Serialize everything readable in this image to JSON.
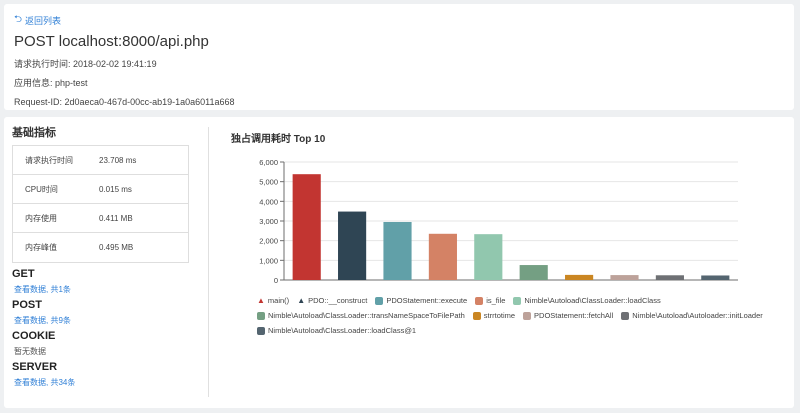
{
  "header": {
    "back_label": "返回列表",
    "request_title": "POST localhost:8000/api.php",
    "exec_time_line": "请求执行时间: 2018-02-02 19:41:19",
    "app_line": "应用信息: php-test",
    "request_id_line": "Request-ID: 2d0aeca0-467d-00cc-ab19-1a0a6011a668"
  },
  "metrics": {
    "title": "基础指标",
    "rows": [
      {
        "key": "请求执行时间",
        "value": "23.708 ms"
      },
      {
        "key": "CPU时间",
        "value": "0.015 ms"
      },
      {
        "key": "内存使用",
        "value": "0.411 MB"
      },
      {
        "key": "内存峰值",
        "value": "0.495 MB"
      }
    ]
  },
  "groups": [
    {
      "title": "GET",
      "link": "查看数据, 共1条"
    },
    {
      "title": "POST",
      "link": "查看数据, 共9条"
    },
    {
      "title": "COOKIE",
      "empty": "暂无数据"
    },
    {
      "title": "SERVER",
      "link": "查看数据, 共34条"
    }
  ],
  "colors": {
    "accent": "#2f7fd6"
  },
  "chart_data": {
    "type": "bar",
    "title": "独占调用耗时 Top 10",
    "ylim": [
      0,
      6000
    ],
    "yticks": [
      "0",
      "1,000",
      "2,000",
      "3,000",
      "4,000",
      "5,000",
      "6,000"
    ],
    "grid": true,
    "legend_position": "bottom",
    "series": [
      {
        "name": "main()",
        "value": 5380,
        "color": "#c23531",
        "icon": "flame-icon"
      },
      {
        "name": "PDO::__construct",
        "value": 3480,
        "color": "#2f4554",
        "icon": "flame-icon"
      },
      {
        "name": "PDOStatement::execute",
        "value": 2950,
        "color": "#61a0a8"
      },
      {
        "name": "is_file",
        "value": 2350,
        "color": "#d48265"
      },
      {
        "name": "Nimble\\Autoload\\ClassLoader::loadClass",
        "value": 2330,
        "color": "#91c7ae"
      },
      {
        "name": "Nimble\\Autoload\\ClassLoader::transNameSpaceToFilePath",
        "value": 760,
        "color": "#749f83"
      },
      {
        "name": "strrtotime",
        "value": 260,
        "color": "#ca8622"
      },
      {
        "name": "PDOStatement::fetchAll",
        "value": 250,
        "color": "#bda29a"
      },
      {
        "name": "Nimble\\Autoload\\Autoloader::initLoader",
        "value": 240,
        "color": "#6e7074"
      },
      {
        "name": "Nimble\\Autoload\\ClassLoader::loadClass@1",
        "value": 230,
        "color": "#546570"
      }
    ]
  }
}
